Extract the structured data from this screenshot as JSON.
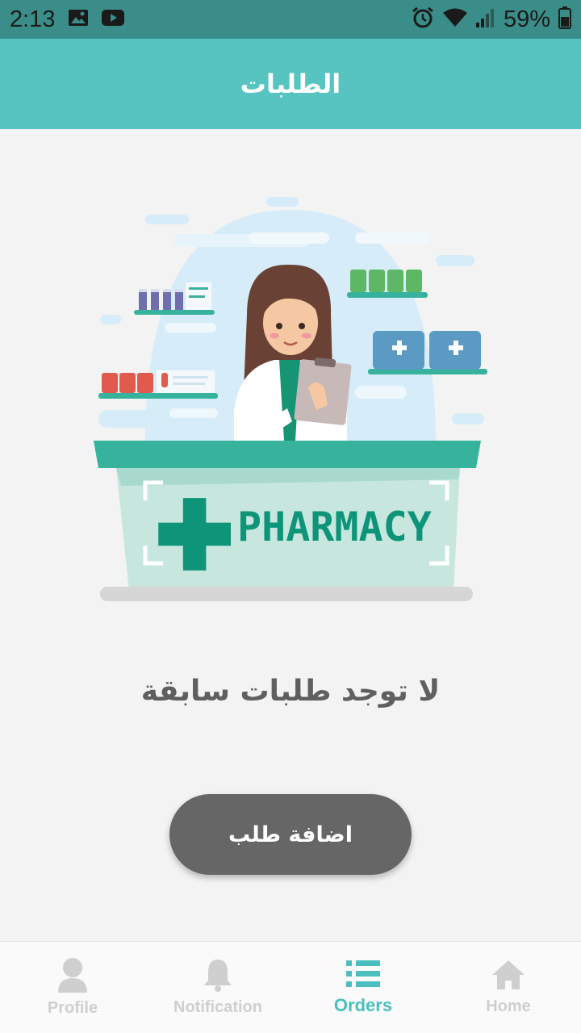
{
  "status_bar": {
    "time": "2:13",
    "battery_percent": "59%",
    "icons": [
      "image-icon",
      "youtube-icon",
      "alarm-icon",
      "wifi-icon",
      "signal-icon",
      "battery-icon"
    ]
  },
  "app_bar": {
    "title": "الطلبات"
  },
  "main": {
    "illustration_sign_text": "PHARMACY",
    "empty_message": "لا توجد طلبات سابقة",
    "add_button_label": "اضافة طلب"
  },
  "bottom_nav": {
    "items": [
      {
        "label": "Profile",
        "icon": "person-icon",
        "active": false
      },
      {
        "label": "Notification",
        "icon": "bell-icon",
        "active": false
      },
      {
        "label": "Orders",
        "icon": "list-icon",
        "active": true
      },
      {
        "label": "Home",
        "icon": "home-icon",
        "active": false
      }
    ]
  },
  "colors": {
    "status_bar": "#3a8d88",
    "app_bar": "#58c4c1",
    "accent": "#4bbfbf",
    "button": "#666666",
    "inactive": "#cfcfcf"
  }
}
